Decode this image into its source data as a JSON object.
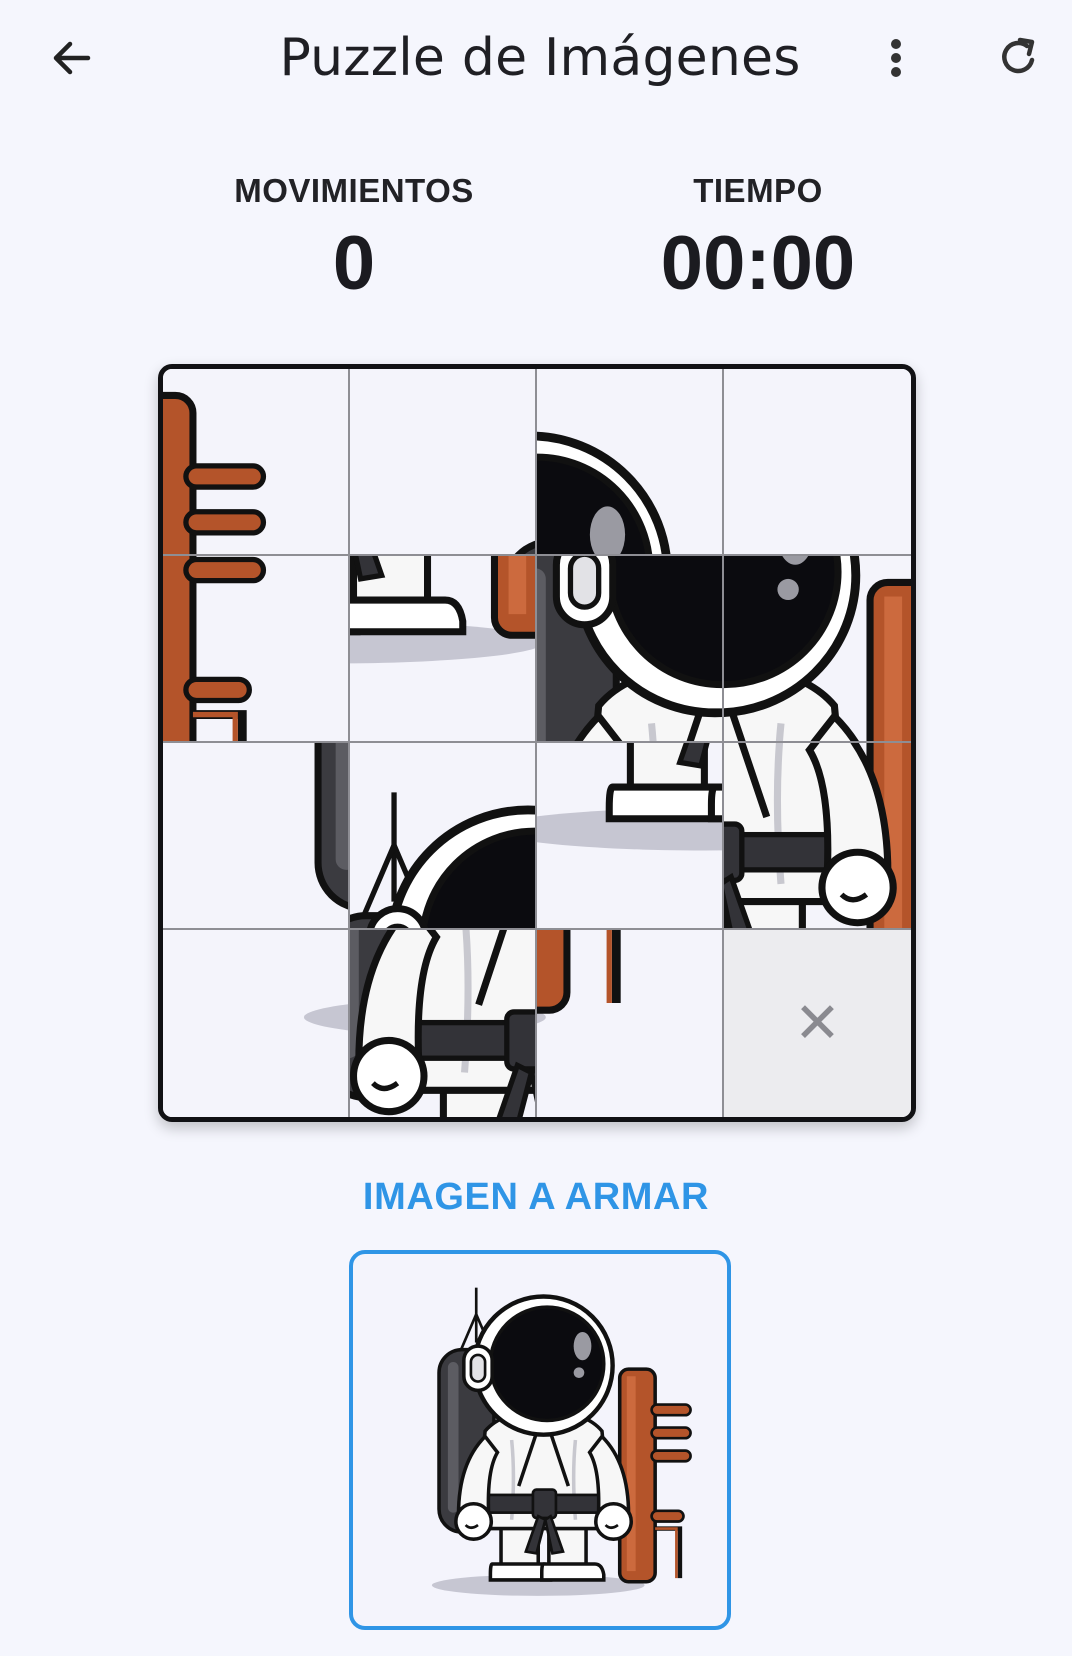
{
  "app_bar": {
    "title": "Puzzle de Imágenes",
    "back_icon": "arrow-left-icon",
    "menu_icon": "more-vert-icon",
    "refresh_icon": "refresh-icon"
  },
  "stats": {
    "moves_label": "MOVIMIENTOS",
    "moves_value": "0",
    "time_label": "TIEMPO",
    "time_value": "00:00"
  },
  "board": {
    "size": 4,
    "empty_symbol": "✕",
    "tile_order": [
      8,
      1,
      3,
      4,
      12,
      15,
      6,
      7,
      9,
      2,
      14,
      11,
      13,
      10,
      16,
      0
    ]
  },
  "reference": {
    "label": "IMAGEN A ARMAR"
  },
  "colors": {
    "accent": "#2f95e6",
    "background": "#f5f6fd",
    "tile_border": "#8e8e94",
    "wood": "#b4542a",
    "bag": "#3a3a3e"
  }
}
